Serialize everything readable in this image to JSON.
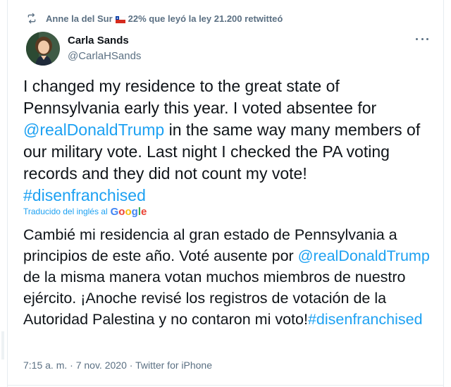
{
  "retweet": {
    "icon": "retweet-icon",
    "user_prefix": "Anne la del Sur",
    "flag": "chile-flag",
    "user_suffix": "22% que leyó la ley 21.200",
    "action": "retwitteó"
  },
  "author": {
    "name": "Carla Sands",
    "handle": "@CarlaHSands"
  },
  "tweet": {
    "text_part1": "I changed my residence to the great state of Pennsylvania early this year. I voted absentee for ",
    "mention": "@realDonaldTrump",
    "text_part2": " in the same way many members of our military vote. Last night I checked the PA voting records and they did not count my vote! ",
    "hashtag": "#disenfranchised"
  },
  "translation_label": "Traducido del inglés al",
  "translation_brand": {
    "g1": "G",
    "o1": "o",
    "o2": "o",
    "g2": "g",
    "l": "l",
    "e": "e"
  },
  "translation": {
    "text_part1": "Cambié mi residencia al gran estado de Pennsylvania a principios de este año. Voté ausente por ",
    "mention": "@realDonaldTrump",
    "text_part2": " de la misma manera votan muchos miembros de nuestro ejército. ¡Anoche revisé los registros de votación de la Autoridad Palestina y no contaron mi voto!",
    "hashtag": "#disenfranchised"
  },
  "meta": {
    "time": "7:15 a. m.",
    "separator": "·",
    "date": "7 nov. 2020",
    "source": "Twitter for iPhone"
  },
  "colors": {
    "link": "#1da1f2",
    "secondary_text": "#5b7083",
    "primary_text": "#0f1419"
  }
}
